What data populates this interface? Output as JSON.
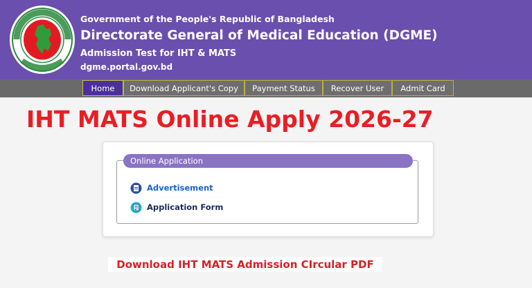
{
  "header": {
    "line1": "Government of the People's Republic of Bangladesh",
    "line2": "Directorate General of Medical Education (DGME)",
    "line3": "Admission Test for IHT & MATS",
    "line4": "dgme.portal.gov.bd",
    "seal_icon": "bangladesh-government-seal",
    "colors": {
      "header_bg": "#6a4fae",
      "nav_bg": "#6a6a6a",
      "active_tab": "#4b2f9e",
      "title_red": "#e81e24"
    }
  },
  "nav": {
    "items": [
      {
        "label": "Home",
        "active": true
      },
      {
        "label": "Download Applicant's Copy",
        "active": false
      },
      {
        "label": "Payment Status",
        "active": false
      },
      {
        "label": "Recover User",
        "active": false
      },
      {
        "label": "Admit Card",
        "active": false
      }
    ]
  },
  "main": {
    "title": "IHT MATS Online Apply 2026-27",
    "panel": {
      "legend": "Online Application",
      "links": [
        {
          "label": "Advertisement",
          "icon": "pdf-icon"
        },
        {
          "label": "Application Form",
          "icon": "form-icon"
        }
      ]
    },
    "download_banner": "Download IHT MATS Admission CIrcular PDF"
  }
}
